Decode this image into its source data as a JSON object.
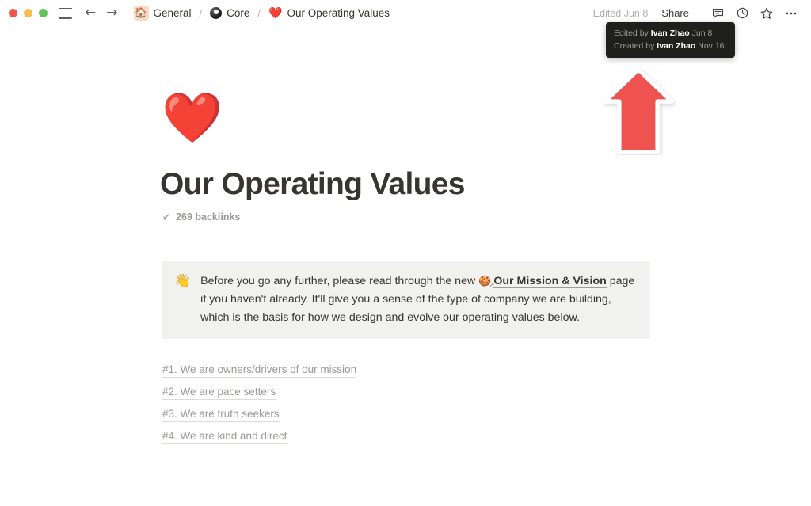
{
  "window": {
    "traffic_lights": [
      "close",
      "minimize",
      "maximize"
    ],
    "colors": {
      "close": "#f1564b",
      "minimize": "#f5bd4f",
      "maximize": "#61c454",
      "accent_arrow": "#ef5350",
      "callout_bg": "#f1f1ef",
      "title_color": "#37352f",
      "muted_text": "#9b9a97"
    }
  },
  "topbar": {
    "menu_icon": "hamburger-menu-icon",
    "back_arrow": "←",
    "forward_arrow": "→",
    "breadcrumb": [
      {
        "emoji": "🏠",
        "label": "General",
        "icon_name": "house-emoji"
      },
      {
        "emoji": "🎱",
        "label": "Core",
        "icon_name": "eight-ball-emoji"
      },
      {
        "emoji": "❤️",
        "label": "Our Operating Values",
        "icon_name": "red-heart-emoji"
      }
    ],
    "separator": "/",
    "edited_label": "Edited Jun 8",
    "share_label": "Share",
    "icons": [
      "comment-icon",
      "history-clock-icon",
      "star-favorite-icon",
      "more-options-icon"
    ]
  },
  "tooltip": {
    "visible": true,
    "edited_prefix": "Edited by",
    "edited_author": "Ivan Zhao",
    "edited_date": "Jun 8",
    "created_prefix": "Created by",
    "created_author": "Ivan Zhao",
    "created_date": "Nov 16"
  },
  "annotation": {
    "shape": "up-arrow-sticker",
    "color": "#ef5350",
    "outline": "#ffffff",
    "points_to": "edited-jun-8-label"
  },
  "page": {
    "emoji": "❤️",
    "emoji_name": "red-heart-emoji",
    "title": "Our Operating Values",
    "backlinks_icon": "↙",
    "backlinks_label": "269 backlinks",
    "backlinks_count": 269
  },
  "callout": {
    "icon": "👋",
    "icon_name": "waving-hand-emoji",
    "text_before_link": "Before you go any further, please read through the new",
    "link_emoji": "🍪",
    "link_text": "Our Mission & Vision",
    "text_after_link": "page if you haven't already. It'll give you a sense of the type of company we are building, which is the basis for how we design and evolve our operating values below."
  },
  "values": {
    "items": [
      {
        "label": "#1. We are owners/drivers of our mission"
      },
      {
        "label": "#2. We are pace setters"
      },
      {
        "label": "#3. We are truth seekers"
      },
      {
        "label": "#4. We are kind and direct"
      }
    ]
  }
}
